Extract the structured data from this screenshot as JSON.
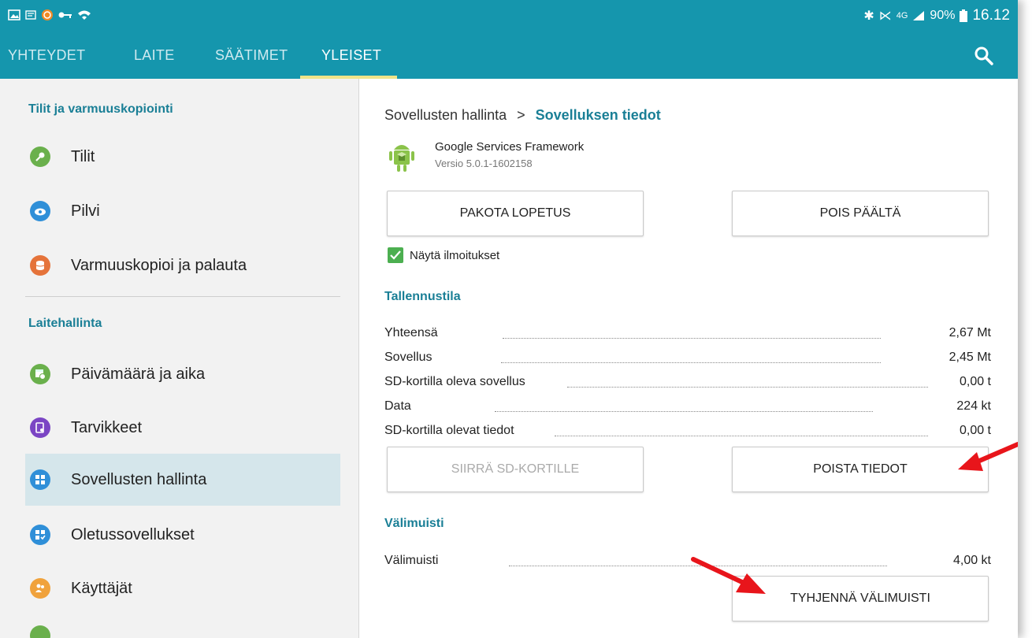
{
  "status": {
    "battery": "90%",
    "time": "16.12",
    "network": "4G"
  },
  "tabs": [
    {
      "label": "YHTEYDET"
    },
    {
      "label": "LAITE"
    },
    {
      "label": "SÄÄTIMET"
    },
    {
      "label": "YLEISET"
    }
  ],
  "sidebar": {
    "section1": "Tilit ja varmuuskopiointi",
    "section2": "Laitehallinta",
    "items": [
      {
        "label": "Tilit"
      },
      {
        "label": "Pilvi"
      },
      {
        "label": "Varmuuskopioi ja palauta"
      },
      {
        "label": "Päivämäärä ja aika"
      },
      {
        "label": "Tarvikkeet"
      },
      {
        "label": "Sovellusten hallinta"
      },
      {
        "label": "Oletussovellukset"
      },
      {
        "label": "Käyttäjät"
      }
    ]
  },
  "breadcrumb": {
    "parent": "Sovellusten hallinta",
    "sep": ">",
    "current": "Sovelluksen tiedot"
  },
  "app": {
    "name": "Google Services Framework",
    "version": "Versio 5.0.1-1602158"
  },
  "buttons": {
    "force_stop": "PAKOTA LOPETUS",
    "disable": "POIS PÄÄLTÄ",
    "move_sd": "SIIRRÄ SD-KORTILLE",
    "clear_data": "POISTA TIEDOT",
    "clear_cache": "TYHJENNÄ VÄLIMUISTI"
  },
  "notifications": {
    "label": "Näytä ilmoitukset",
    "checked": true
  },
  "storage": {
    "title": "Tallennustila",
    "rows": [
      {
        "label": "Yhteensä",
        "value": "2,67 Mt"
      },
      {
        "label": "Sovellus",
        "value": "2,45 Mt"
      },
      {
        "label": "SD-kortilla oleva sovellus",
        "value": "0,00 t"
      },
      {
        "label": "Data",
        "value": "224 kt"
      },
      {
        "label": "SD-kortilla olevat tiedot",
        "value": "0,00 t"
      }
    ]
  },
  "cache": {
    "title": "Välimuisti",
    "label": "Välimuisti",
    "value": "4,00 kt"
  },
  "colors": {
    "accent": "#1596ad",
    "tab_underline": "#f0e489",
    "annotation_arrow": "#e8151b"
  }
}
